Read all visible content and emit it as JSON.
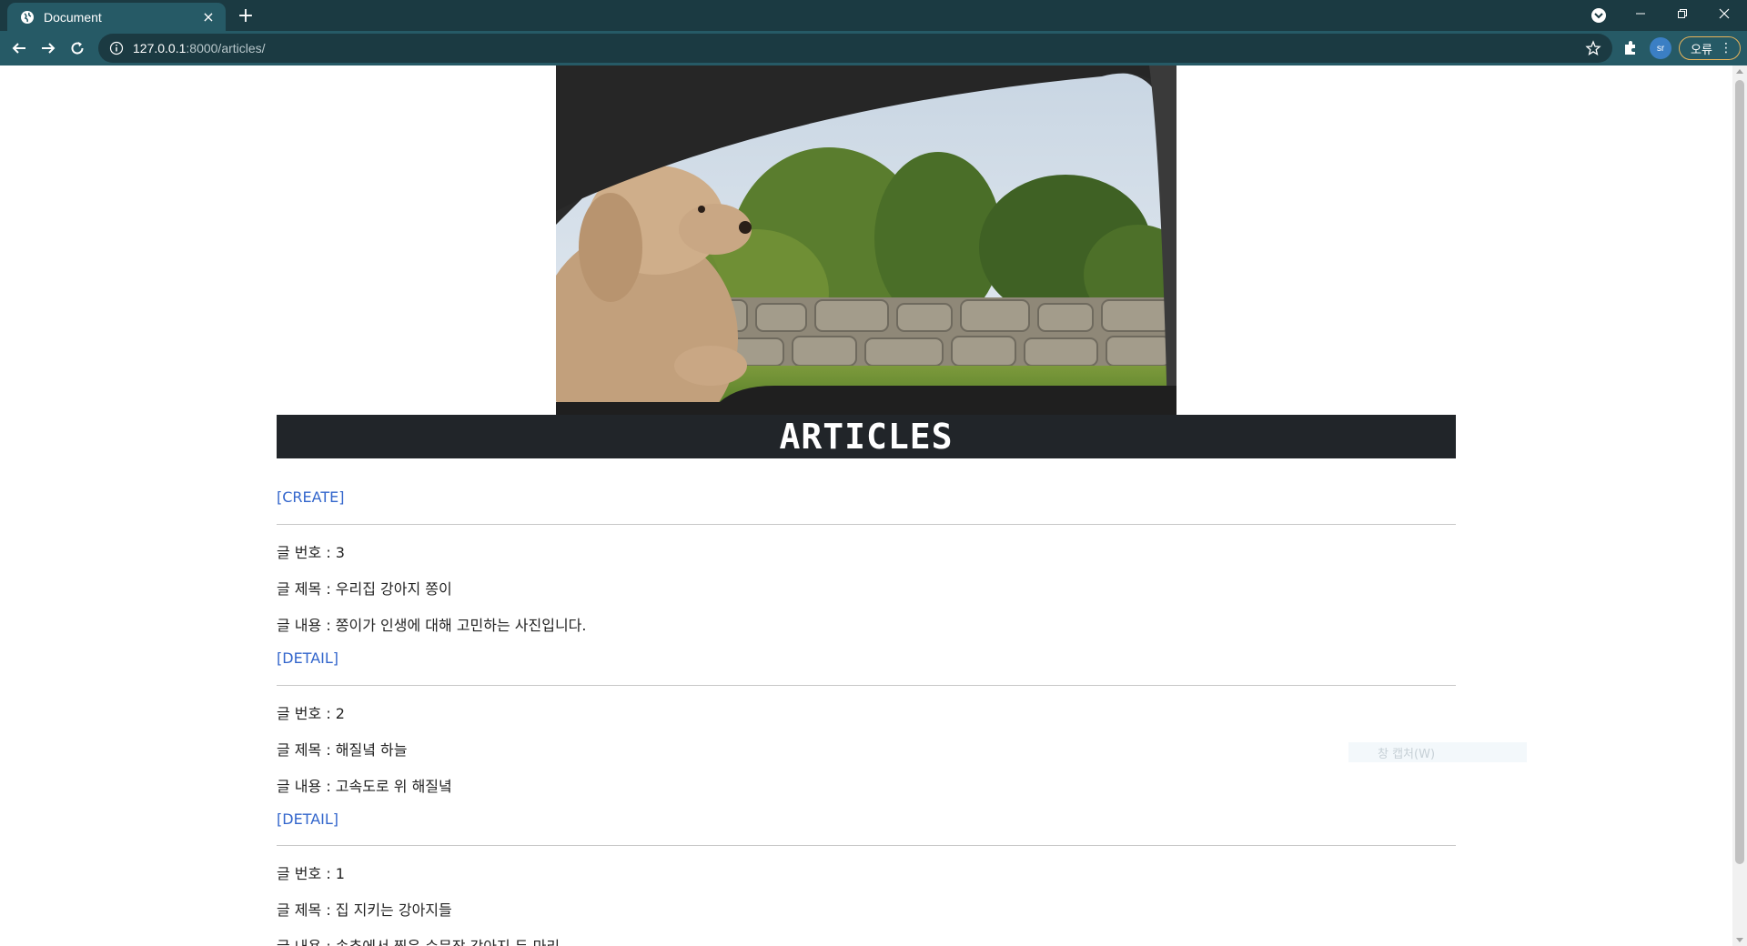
{
  "browser": {
    "tab_title": "Document",
    "tab_close": "×",
    "new_tab": "+",
    "url_host": "127.0.0.1",
    "url_path": ":8000/articles/",
    "profile_initials": "sr",
    "error_label": "오류",
    "error_menu": "⋮"
  },
  "page": {
    "heading": "ARTICLES",
    "create_link": "[CREATE]",
    "articles": [
      {
        "number_line": "글 번호 : 3",
        "title_line": "글 제목 : 우리집 강아지 쫑이",
        "content_line": "글 내용 : 쫑이가 인생에 대해 고민하는 사진입니다.",
        "detail_link": "[DETAIL]"
      },
      {
        "number_line": "글 번호 : 2",
        "title_line": "글 제목 : 해질녘 하늘",
        "content_line": "글 내용 : 고속도로 위 해질녘",
        "detail_link": "[DETAIL]"
      },
      {
        "number_line": "글 번호 : 1",
        "title_line": "글 제목 : 집 지키는 강아지들",
        "content_line": "글 내용 : 송추에서 찍은 수문장 강아지 두 마리"
      }
    ],
    "capture_overlay": "창 캡처(W)"
  },
  "colors": {
    "tabbar": "#1b3a42",
    "toolbar": "#265a66",
    "heading_bg": "#212529",
    "link": "#3366cc"
  }
}
